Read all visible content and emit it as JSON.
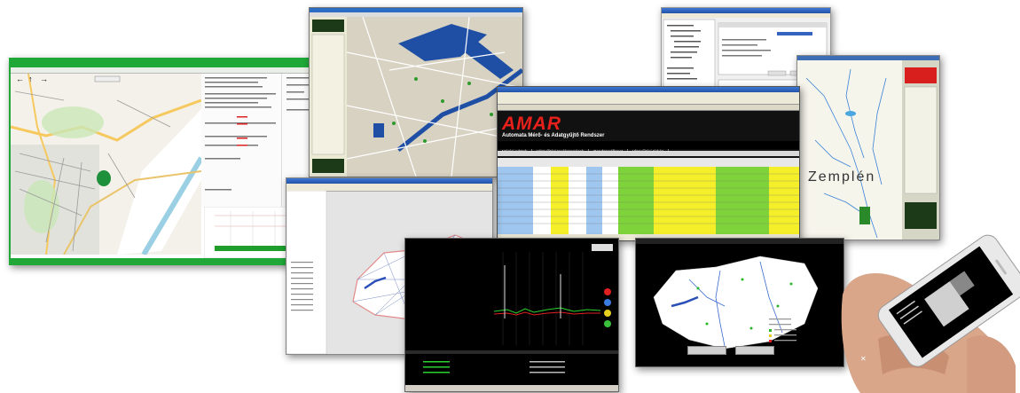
{
  "amar": {
    "logo": "AMAR",
    "subtitle": "Automata Mérő- és Adatgyűjtő Rendszer",
    "nav": [
      "Mérési adatok",
      "Vízgyűjtési tevékenységek",
      "Rendszerállapot",
      "Vízgyűjtési térkép"
    ]
  },
  "zemplen": {
    "label": "Zemplén"
  },
  "colors": {
    "window_green": "#1fa838",
    "amar_red": "#e8201c",
    "cell_yellow": "#f5ef2a",
    "cell_green": "#7fd33a",
    "cell_blue": "#9ec6ee",
    "alarm_red": "#e02020"
  },
  "icons": [
    "back-arrow-icon",
    "up-arrow-icon",
    "forward-arrow-icon",
    "windows-close-icon"
  ]
}
